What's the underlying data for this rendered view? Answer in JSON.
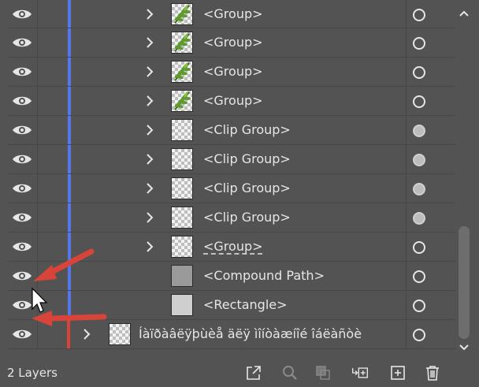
{
  "rows": [
    {
      "label": "<Group>",
      "color": "#5577e8",
      "chevron": true,
      "thumb": "fern",
      "target": "hollow"
    },
    {
      "label": "<Group>",
      "color": "#5577e8",
      "chevron": true,
      "thumb": "fern",
      "target": "hollow"
    },
    {
      "label": "<Group>",
      "color": "#5577e8",
      "chevron": true,
      "thumb": "fern",
      "target": "hollow"
    },
    {
      "label": "<Group>",
      "color": "#5577e8",
      "chevron": true,
      "thumb": "fern",
      "target": "hollow"
    },
    {
      "label": "<Clip Group>",
      "color": "#5577e8",
      "chevron": true,
      "thumb": "checker",
      "target": "filled"
    },
    {
      "label": "<Clip Group>",
      "color": "#5577e8",
      "chevron": true,
      "thumb": "checker",
      "target": "filled"
    },
    {
      "label": "<Clip Group>",
      "color": "#5577e8",
      "chevron": true,
      "thumb": "checker",
      "target": "filled"
    },
    {
      "label": "<Clip Group>",
      "color": "#5577e8",
      "chevron": true,
      "thumb": "checker",
      "target": "filled"
    },
    {
      "label": "<Group>",
      "color": "#5577e8",
      "chevron": true,
      "thumb": "checker",
      "target": "hollow",
      "dashed": true
    },
    {
      "label": "<Compound Path>",
      "color": "#5577e8",
      "chevron": false,
      "thumb": "gray",
      "target": "hollow"
    },
    {
      "label": "<Rectangle>",
      "color": "#5577e8",
      "chevron": false,
      "thumb": "lightgray",
      "target": "hollow"
    },
    {
      "label": "Íàïðàâëÿþùèå äëÿ ìîíòàæíîé îáëàñòè",
      "color": "#d9443a",
      "chevron": true,
      "thumb": "checker",
      "target": "hollow",
      "toplevel": true
    }
  ],
  "footer": {
    "layers_count": "2 Layers",
    "icons": [
      "export-icon",
      "search-icon",
      "clip-mask-icon",
      "new-sublayer-icon",
      "new-layer-icon",
      "trash-icon"
    ]
  },
  "annotation_color": "#d9443a"
}
